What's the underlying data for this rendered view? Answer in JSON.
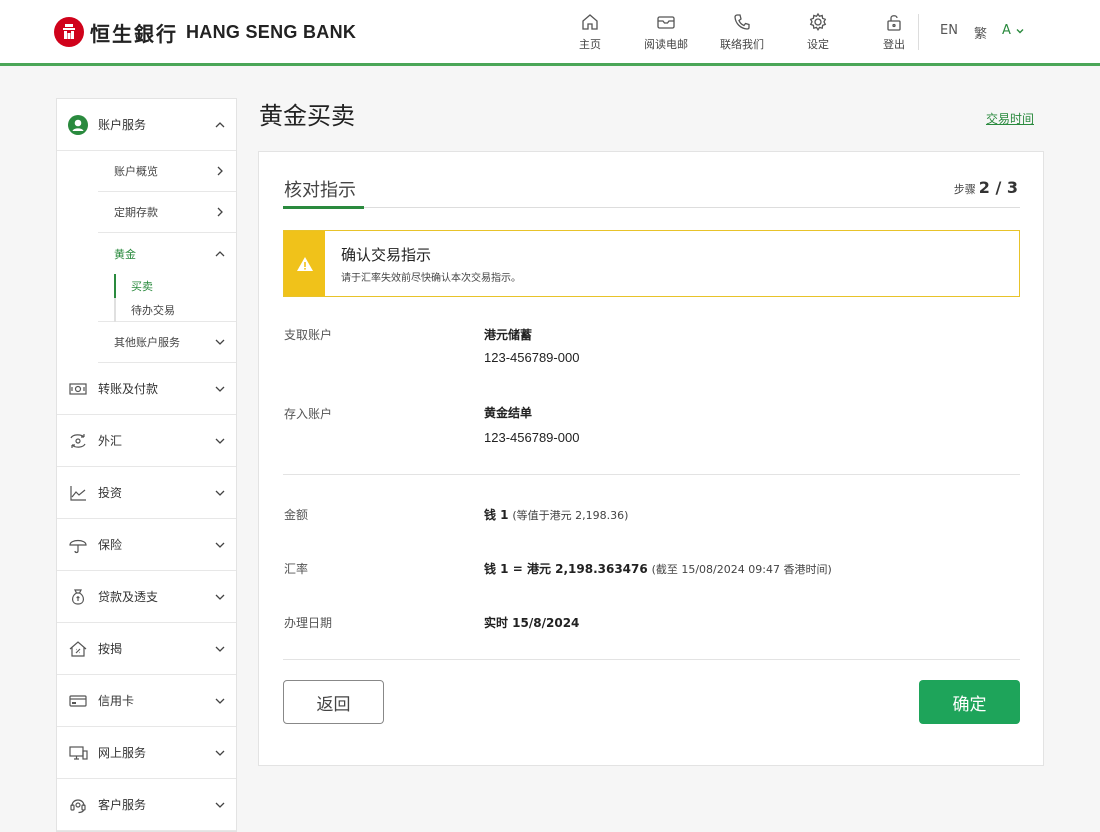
{
  "brand": {
    "name_cn": "恒生銀行",
    "name_en": "HANG SENG BANK",
    "accent": "#2a8a3e",
    "logo_color": "#d0021b"
  },
  "nav": [
    {
      "label": "主页",
      "icon": "home-icon"
    },
    {
      "label": "阅读电邮",
      "icon": "mail-icon"
    },
    {
      "label": "联络我们",
      "icon": "phone-icon"
    },
    {
      "label": "设定",
      "icon": "gear-icon"
    },
    {
      "label": "登出",
      "icon": "lock-icon"
    }
  ],
  "lang": {
    "en": "EN",
    "tc": "繁",
    "font": "A"
  },
  "sidebar": {
    "account_services": "账户服务",
    "sub": {
      "overview": "账户概览",
      "fixed_deposit": "定期存款",
      "gold": "黄金",
      "gold_buy_sell": "买卖",
      "gold_pending": "待办交易",
      "other": "其他账户服务"
    },
    "items": [
      {
        "label": "转账及付款",
        "icon": "transfer-icon"
      },
      {
        "label": "外汇",
        "icon": "fx-icon"
      },
      {
        "label": "投资",
        "icon": "chart-icon"
      },
      {
        "label": "保险",
        "icon": "umbrella-icon"
      },
      {
        "label": "贷款及透支",
        "icon": "moneybag-icon"
      },
      {
        "label": "按揭",
        "icon": "house-icon"
      },
      {
        "label": "信用卡",
        "icon": "card-icon"
      },
      {
        "label": "网上服务",
        "icon": "computer-icon"
      },
      {
        "label": "客户服务",
        "icon": "headset-icon"
      }
    ]
  },
  "main": {
    "title": "黄金买卖",
    "trade_time": "交易时间",
    "card_title": "核对指示",
    "step_label": "步骤",
    "step_value": "2 / 3",
    "notice_title": "确认交易指示",
    "notice_text": "请于汇率失效前尽快确认本次交易指示。",
    "debit_label": "支取账户",
    "debit_name": "港元储蓄",
    "debit_number": "123-456789-000",
    "credit_label": "存入账户",
    "credit_name": "黄金结单",
    "credit_number": "123-456789-000",
    "amount_label": "金额",
    "amount_value": "钱 1",
    "amount_note": "(等值于港元 2,198.36)",
    "rate_label": "汇率",
    "rate_value": "钱 1 = 港元 2,198.363476",
    "rate_note": "(截至 15/08/2024 09:47 香港时间)",
    "date_label": "办理日期",
    "date_value": "实时 15/8/2024",
    "back_button": "返回",
    "confirm_button": "确定"
  }
}
